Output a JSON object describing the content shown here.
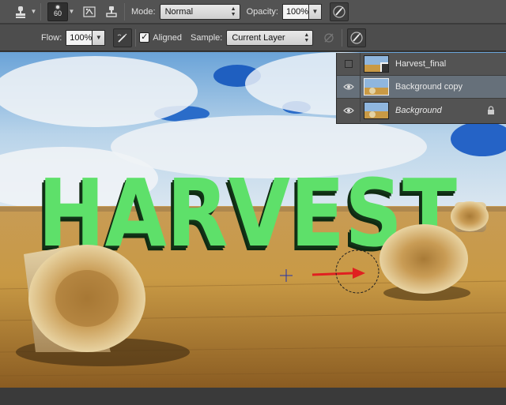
{
  "options_bar": {
    "brush_size": "60",
    "mode_label": "Mode:",
    "mode_value": "Normal",
    "opacity_label": "Opacity:",
    "opacity_value": "100%",
    "flow_label": "Flow:",
    "flow_value": "100%",
    "aligned_label": "Aligned",
    "aligned_checked": true,
    "sample_label": "Sample:",
    "sample_value": "Current Layer"
  },
  "layers": [
    {
      "name": "Harvest_final",
      "visible": false,
      "selected": false,
      "italic": false,
      "locked": false
    },
    {
      "name": "Background copy",
      "visible": true,
      "selected": true,
      "italic": false,
      "locked": false
    },
    {
      "name": "Background",
      "visible": true,
      "selected": false,
      "italic": true,
      "locked": true
    }
  ],
  "canvas": {
    "headline_text": "HARVEST",
    "headline_color": "#5ee06a",
    "headline_shadow_color": "#0f2a12"
  },
  "colors": {
    "panel_bg": "#535353",
    "selected_layer": "#66707a",
    "sky_blue": "#2a6cc9",
    "field_gold": "#c99a45"
  }
}
